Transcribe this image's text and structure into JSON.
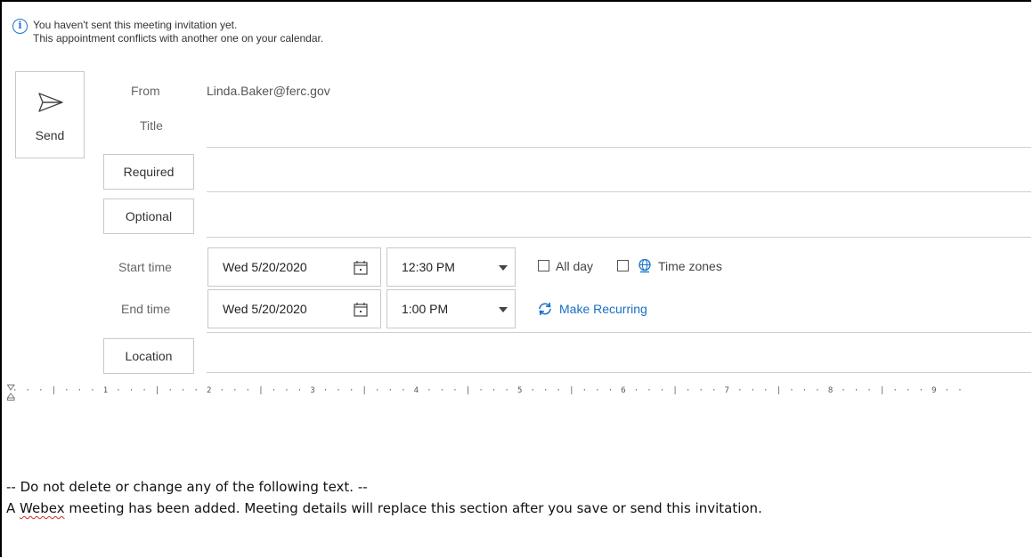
{
  "info": {
    "line1": "You haven't sent this meeting invitation yet.",
    "line2": "This appointment conflicts with another one on your calendar."
  },
  "send": {
    "label": "Send",
    "icon": "send-icon"
  },
  "from": {
    "label": "From",
    "value": "Linda.Baker@ferc.gov"
  },
  "title": {
    "label": "Title",
    "value": ""
  },
  "required": {
    "label": "Required",
    "value": ""
  },
  "optional": {
    "label": "Optional",
    "value": ""
  },
  "start": {
    "label": "Start time",
    "date": "Wed 5/20/2020",
    "time": "12:30 PM"
  },
  "end": {
    "label": "End time",
    "date": "Wed 5/20/2020",
    "time": "1:00 PM"
  },
  "allday": {
    "label": "All day",
    "checked": false
  },
  "timezones": {
    "label": "Time zones",
    "checked": false
  },
  "recurring": {
    "label": "Make Recurring"
  },
  "location": {
    "label": "Location",
    "value": ""
  },
  "ruler": {
    "text": "· · · | · · · 1 · · · | · · · 2 · · · | · · · 3 · · · | · · · 4 · · · | · · · 5 · · · | · · · 6 · · · | · · · 7 · · · | · · · 8 · · · | · · · 9 · ·"
  },
  "body": {
    "line1": "-- Do not delete or change any of the following text. --",
    "line2_word1": "A",
    "line2_word2": "Webex",
    "line2_rest": "meeting has been added. Meeting details will replace this section after you save or send this invitation."
  },
  "colors": {
    "accent": "#1a74c9",
    "link": "#1a6fc4",
    "border": "#c8c8c8"
  }
}
